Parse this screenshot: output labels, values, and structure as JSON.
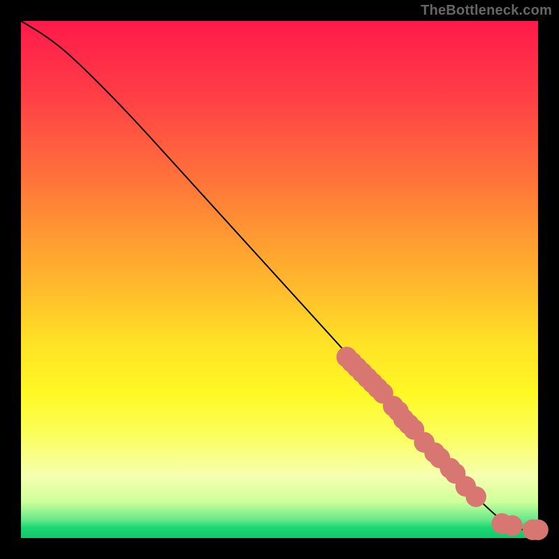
{
  "watermark": "TheBottleneck.com",
  "chart_data": {
    "type": "line",
    "title": "",
    "xlabel": "",
    "ylabel": "",
    "xlim": [
      0,
      100
    ],
    "ylim": [
      0,
      100
    ],
    "series": [
      {
        "name": "curve",
        "x": [
          0,
          5,
          10,
          20,
          30,
          40,
          50,
          60,
          70,
          80,
          86,
          90,
          94,
          97,
          100
        ],
        "values": [
          100,
          97,
          93,
          83,
          72,
          61,
          50,
          39,
          28,
          17,
          10,
          6,
          2.5,
          1.5,
          1.5
        ]
      }
    ],
    "markers": {
      "name": "points",
      "color": "#d87671",
      "radius": 2.0,
      "x": [
        63,
        64,
        65,
        66,
        67,
        68,
        69,
        70,
        72,
        73,
        74,
        75,
        76,
        78,
        80,
        81,
        83,
        84,
        86,
        88,
        93,
        95,
        99,
        100
      ],
      "values": [
        35,
        34,
        33,
        32,
        31,
        30,
        29,
        28,
        25.5,
        24.5,
        23,
        22,
        21,
        18.5,
        16.5,
        15.5,
        13.5,
        12.5,
        10,
        8,
        2.8,
        2.4,
        1.6,
        1.6
      ]
    }
  }
}
